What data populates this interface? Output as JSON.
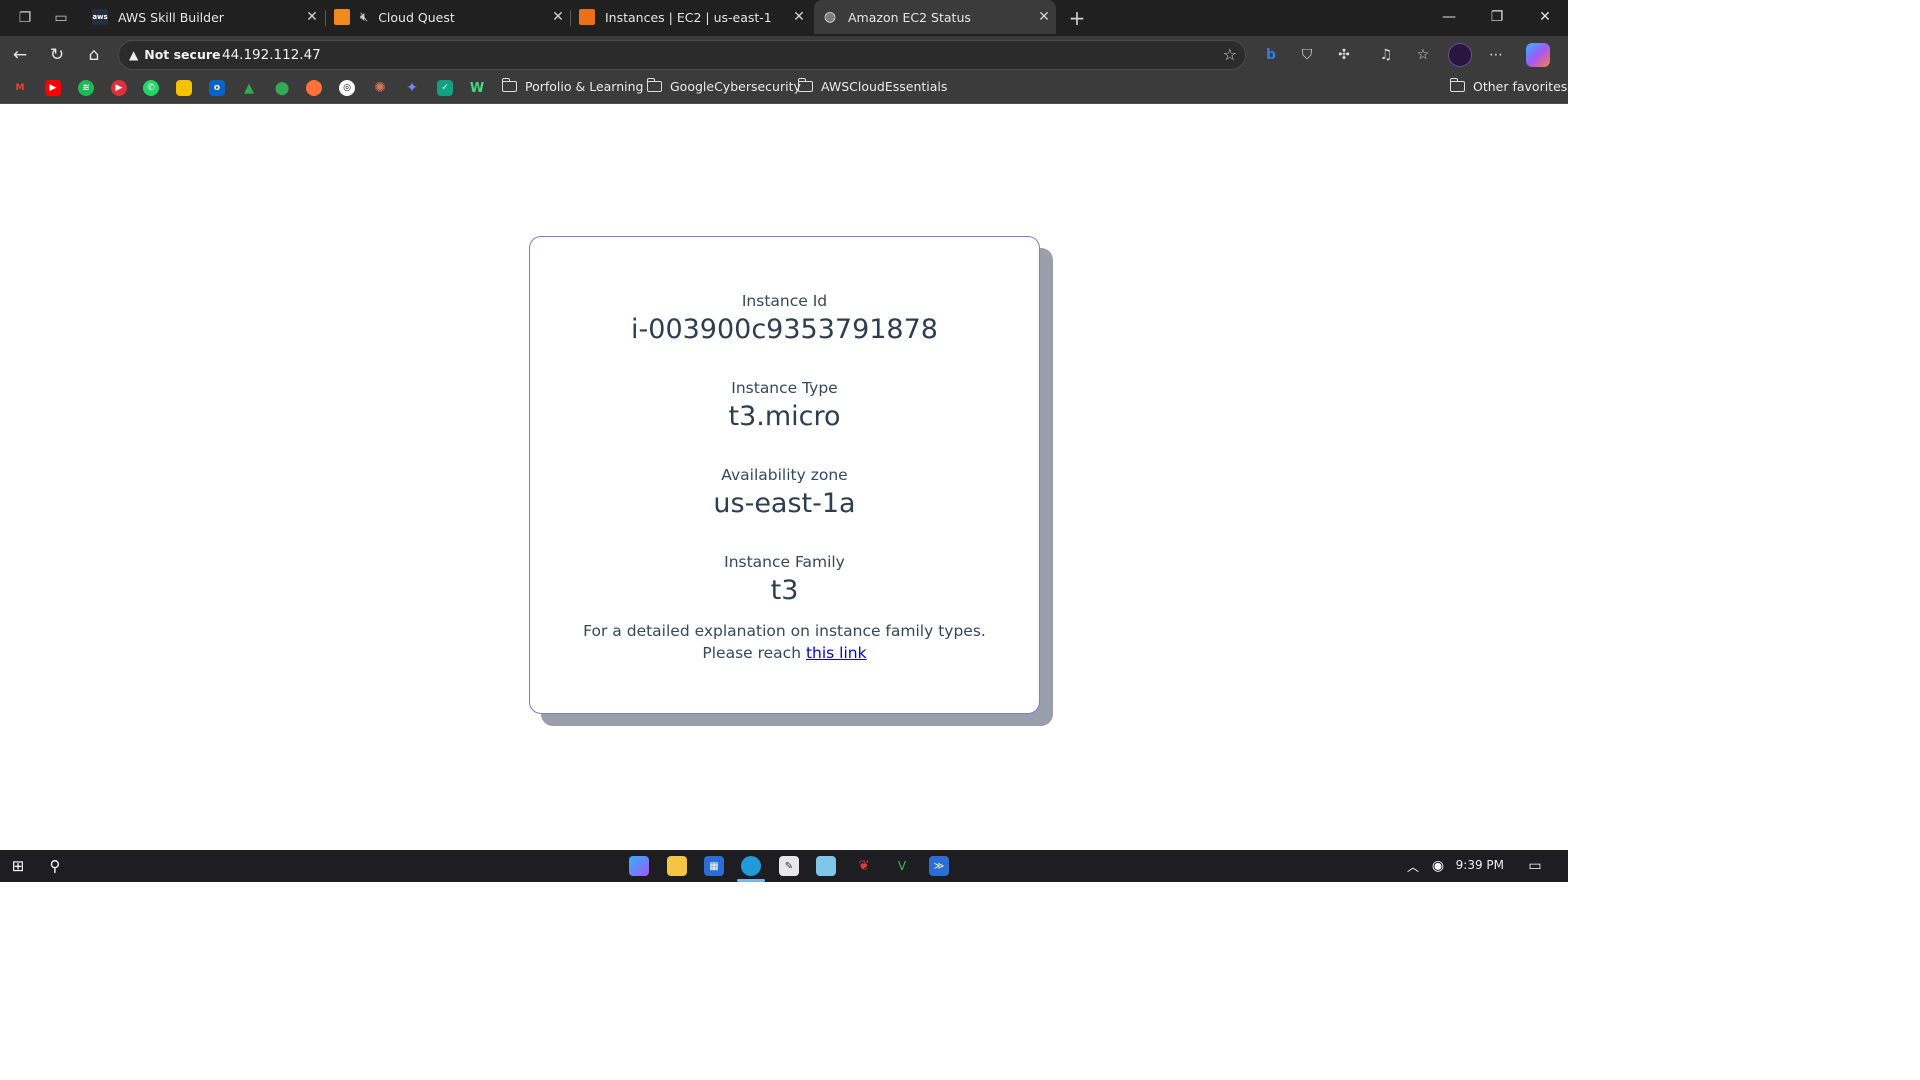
{
  "browser": {
    "tabs": [
      {
        "label": "AWS Skill Builder",
        "favicon": "aws-logo-icon",
        "active": false
      },
      {
        "label": "Cloud Quest",
        "favicon": "cloud-quest-icon",
        "muted": true,
        "active": false
      },
      {
        "label": "Instances | EC2 | us-east-1",
        "favicon": "ec2-icon",
        "active": false
      },
      {
        "label": "Amazon EC2 Status",
        "favicon": "globe-icon",
        "active": true
      }
    ],
    "security_label": "Not secure",
    "url": "44.192.112.47",
    "bookmarks_folders": [
      {
        "label": "Porfolio & Learning"
      },
      {
        "label": "GoogleCybersecurity"
      },
      {
        "label": "AWSCloudEssentials"
      }
    ],
    "other_favorites": "Other favorites"
  },
  "page": {
    "fields": [
      {
        "label": "Instance Id",
        "value": "i-003900c9353791878"
      },
      {
        "label": "Instance Type",
        "value": "t3.micro"
      },
      {
        "label": "Availability zone",
        "value": "us-east-1a"
      },
      {
        "label": "Instance Family",
        "value": "t3"
      }
    ],
    "note_line1": "For a detailed explanation on instance family types.",
    "note_line2_prefix": "Please reach",
    "link_text": "this link"
  },
  "taskbar": {
    "time": "9:39 PM"
  }
}
